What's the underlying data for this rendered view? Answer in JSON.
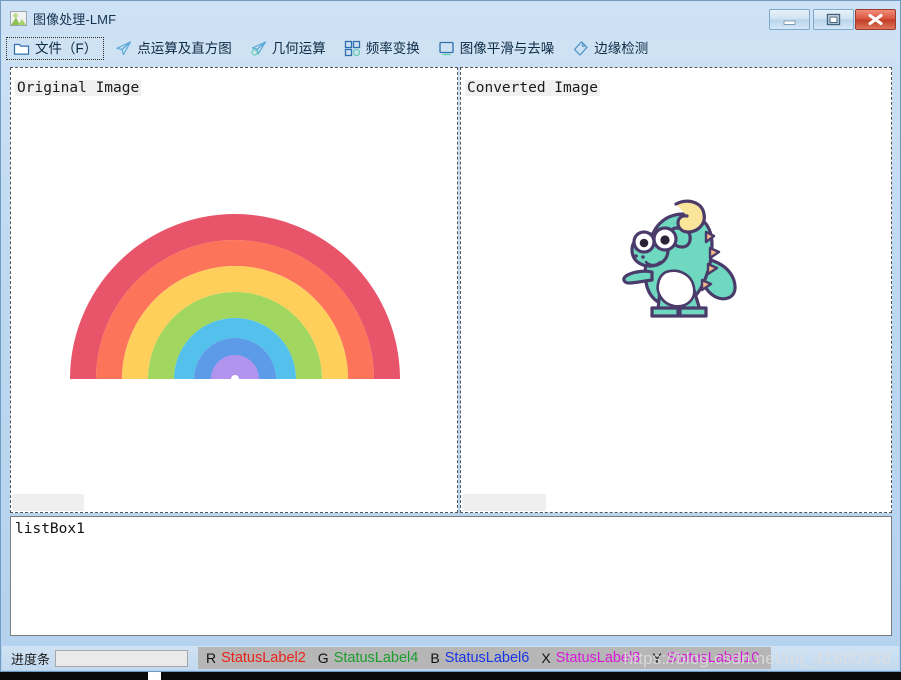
{
  "window": {
    "title": "图像处理-LMF",
    "icon": "picture-icon",
    "controls": [
      {
        "name": "minimize-button",
        "glyph": "minimize"
      },
      {
        "name": "maximize-button",
        "glyph": "maximize"
      },
      {
        "name": "close-button",
        "glyph": "close"
      }
    ]
  },
  "menu": {
    "items": [
      {
        "label": "文件（F）",
        "icon": "folder-icon",
        "focused": true
      },
      {
        "label": "点运算及直方图",
        "icon": "paper-plane-icon",
        "focused": false
      },
      {
        "label": "几何运算",
        "icon": "paper-plane-circle-icon",
        "focused": false
      },
      {
        "label": "频率变换",
        "icon": "grid-squares-icon",
        "focused": false
      },
      {
        "label": "图像平滑与去噪",
        "icon": "square-outline-icon",
        "focused": false
      },
      {
        "label": "边缘检测",
        "icon": "tag-icon",
        "focused": false
      }
    ]
  },
  "panels": {
    "original": {
      "caption": "Original Image",
      "image_name": "rainbow-image"
    },
    "converted": {
      "caption": "Converted Image",
      "image_name": "dinosaur-image"
    }
  },
  "listbox": {
    "name": "listBox1",
    "items": [
      "listBox1"
    ]
  },
  "status": {
    "progress_label": "进度条",
    "progress_value": "",
    "readouts": [
      {
        "key": "R",
        "value": "StatusLabel2",
        "color": "#e8231a"
      },
      {
        "key": "G",
        "value": "StatusLabel4",
        "color": "#1a9e2e"
      },
      {
        "key": "B",
        "value": "StatusLabel6",
        "color": "#1a33e8"
      },
      {
        "key": "X",
        "value": "StatusLabel8",
        "color": "#d81ad8"
      },
      {
        "key": "Y",
        "value": "StatusLabel10",
        "color": "#d81ad8"
      }
    ],
    "watermark": "https://blog.csdn.net/qq_41880738"
  },
  "colors": {
    "rainbow": [
      "#e8556a",
      "#fc7459",
      "#ffcf5c",
      "#a1d75f",
      "#54c1ec",
      "#5b9be8",
      "#b094ee"
    ],
    "dino_body": "#6ed9c0",
    "dino_outline": "#4a3b6b",
    "dino_hair": "#fbe59b",
    "dino_spikes": "#f7b98a",
    "title_bar": "#cfe2f5",
    "close_button": "#d9533b"
  }
}
